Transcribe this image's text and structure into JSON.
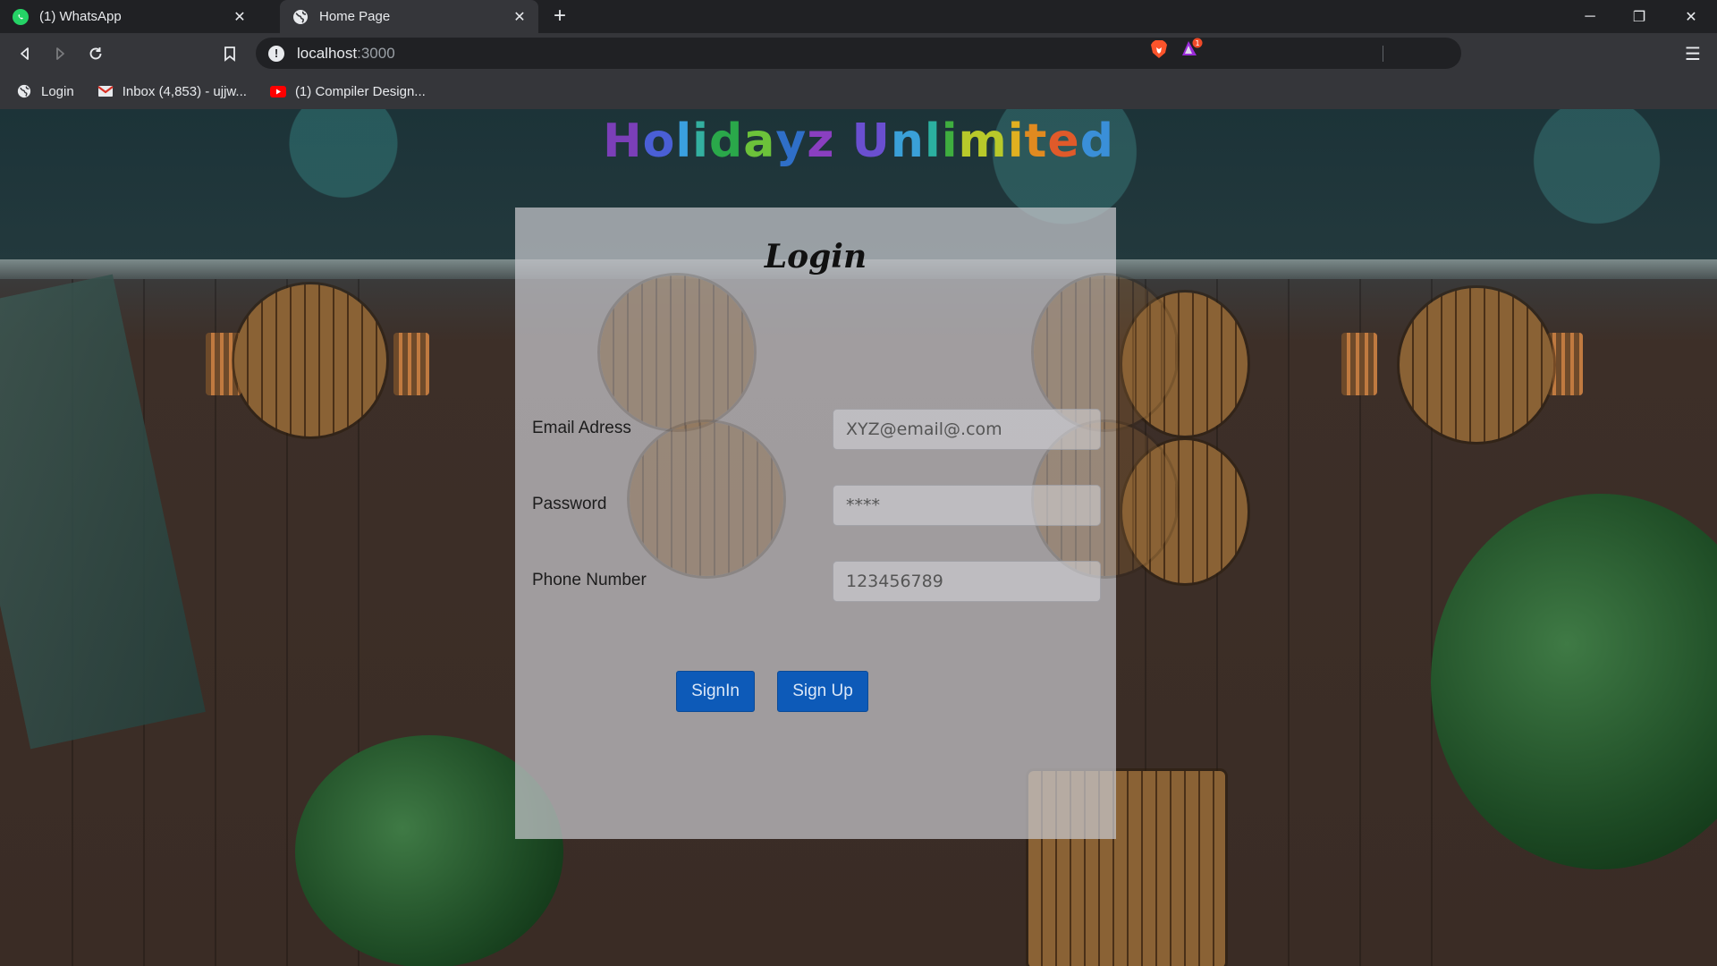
{
  "browser": {
    "tabs": [
      {
        "title": "(1) WhatsApp",
        "active": false,
        "favicon": "whatsapp-icon"
      },
      {
        "title": "Home Page",
        "active": true,
        "favicon": "globe-icon"
      }
    ],
    "url_host": "localhost",
    "url_port": ":3000",
    "bookmarks": [
      {
        "label": "Login",
        "icon": "globe-icon"
      },
      {
        "label": "Inbox (4,853) - ujjw...",
        "icon": "gmail-icon"
      },
      {
        "label": "(1) Compiler Design...",
        "icon": "youtube-icon"
      }
    ],
    "rewards_badge": "1"
  },
  "page": {
    "site_title": "Holidayz Unlimited",
    "title_colors": [
      "#7b3fb8",
      "#4a5fd6",
      "#3aa0e0",
      "#33b0a0",
      "#2aa84a",
      "#6cc23a",
      "#2f6fc8",
      "#8a3fc0",
      "#6a4fd0",
      "#3aa0d8",
      "#2bb0a0",
      "#3fae3f",
      "#b8c92a",
      "#e0b020",
      "#e08a20",
      "#e05a2a",
      "#3a8fd8",
      "#2aaec0"
    ],
    "login": {
      "heading": "Login",
      "fields": [
        {
          "label": "Email Adress",
          "placeholder": "XYZ@email@.com"
        },
        {
          "label": "Password",
          "placeholder": "****"
        },
        {
          "label": "Phone Number",
          "placeholder": "123456789"
        }
      ],
      "signin_label": "SignIn",
      "signup_label": "Sign Up"
    }
  }
}
